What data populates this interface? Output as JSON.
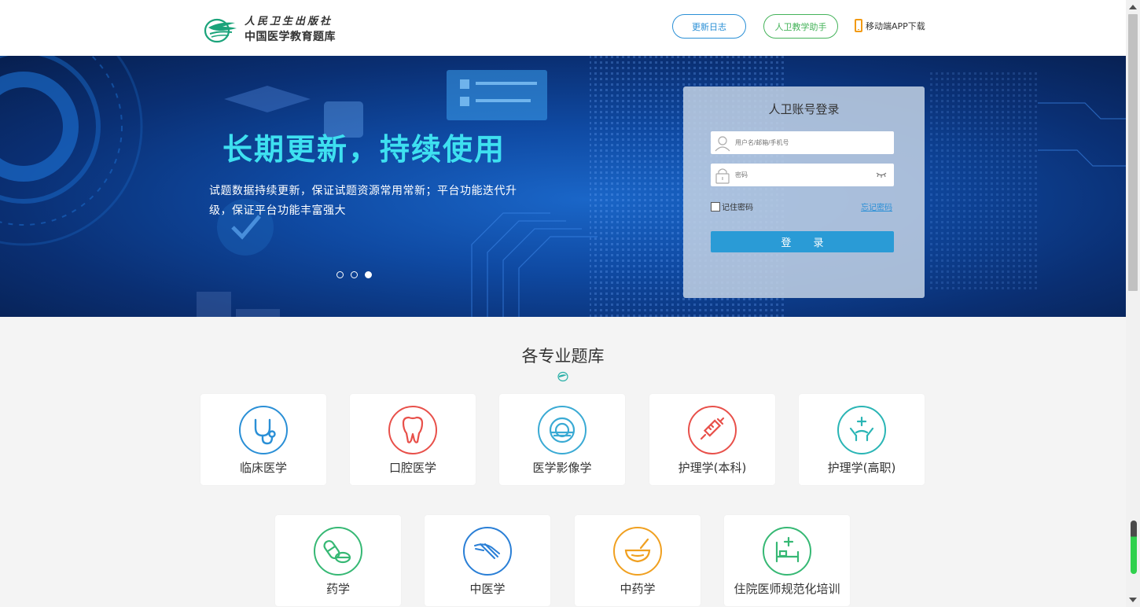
{
  "header": {
    "logo_top": "人民卫生出版社",
    "logo_bottom": "中国医学教育题库",
    "update_log": "更新日志",
    "teaching_assistant": "人卫教学助手",
    "app_download": "移动端APP下载"
  },
  "banner": {
    "title": "长期更新，持续使用",
    "description": "试题数据持续更新，保证试题资源常用常新；平台功能迭代升级，保证平台功能丰富强大",
    "slides": 3,
    "active_slide": 3
  },
  "login": {
    "title": "人卫账号登录",
    "username_placeholder": "用户名/邮箱/手机号",
    "password_placeholder": "密码",
    "remember": "记住密码",
    "forgot": "忘记密码",
    "submit": "登 录"
  },
  "section": {
    "title": "各专业题库",
    "categories": [
      {
        "label": "临床医学",
        "icon": "stethoscope-icon",
        "color": "#2a8fd6"
      },
      {
        "label": "口腔医学",
        "icon": "tooth-icon",
        "color": "#e8504a"
      },
      {
        "label": "医学影像学",
        "icon": "ct-scanner-icon",
        "color": "#3aaad4"
      },
      {
        "label": "护理学(本科)",
        "icon": "syringe-icon",
        "color": "#e8504a"
      },
      {
        "label": "护理学(高职)",
        "icon": "care-hands-icon",
        "color": "#2ab5b5"
      },
      {
        "label": "药学",
        "icon": "pills-icon",
        "color": "#36b874"
      },
      {
        "label": "中医学",
        "icon": "pulse-hand-icon",
        "color": "#2a7fd6"
      },
      {
        "label": "中药学",
        "icon": "mortar-icon",
        "color": "#f0a020"
      },
      {
        "label": "住院医师规范化培训",
        "icon": "hospital-bed-icon",
        "color": "#36b874"
      }
    ]
  }
}
